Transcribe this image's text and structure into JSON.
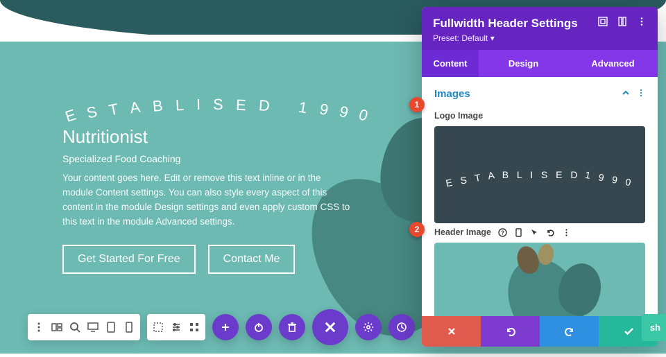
{
  "hero": {
    "logo_text": "ESTABLISED 1990",
    "title": "Nutritionist",
    "subtitle": "Specialized Food Coaching",
    "body": "Your content goes here. Edit or remove this text inline or in the module Content settings. You can also style every aspect of this content in the module Design settings and even apply custom CSS to this text in the module Advanced settings.",
    "cta_primary": "Get Started For Free",
    "cta_secondary": "Contact Me"
  },
  "panel": {
    "title": "Fullwidth Header Settings",
    "preset_label": "Preset: Default",
    "tabs": {
      "content": "Content",
      "design": "Design",
      "advanced": "Advanced"
    },
    "section": "Images",
    "logo_label": "Logo Image",
    "logo_preview_text": "ESTABLISED 1990",
    "header_label": "Header Image"
  },
  "markers": {
    "one": "1",
    "two": "2"
  },
  "share": "sh"
}
